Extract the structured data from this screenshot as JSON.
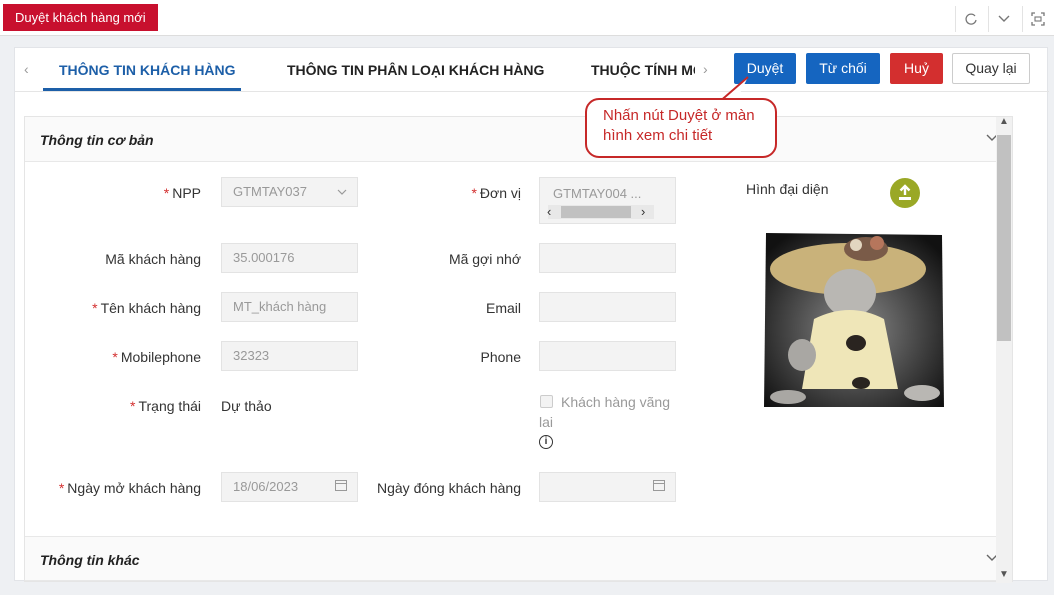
{
  "window": {
    "title": "Duyệt khách hàng mới",
    "controls": [
      "refresh-icon",
      "chevron-down-icon",
      "fullscreen-icon"
    ]
  },
  "tabs": {
    "items": [
      "THÔNG TIN KHÁCH HÀNG",
      "THÔNG TIN PHÂN LOẠI KHÁCH HÀNG",
      "THUỘC TÍNH MC"
    ],
    "prev_arrow": "‹",
    "next_arrow": "›"
  },
  "actions": {
    "approve": "Duyệt",
    "reject": "Từ chối",
    "cancel": "Huỷ",
    "back": "Quay lại"
  },
  "callout": {
    "text": "Nhấn nút Duyệt ở màn hình xem chi tiết"
  },
  "sections": {
    "basic": "Thông tin cơ bản",
    "other": "Thông tin khác"
  },
  "form": {
    "npp_label": "NPP",
    "npp_value": "GTMTAY037",
    "donvi_label": "Đơn vị",
    "donvi_value": "GTMTAY004 ...",
    "ma_kh_label": "Mã khách hàng",
    "ma_kh_value": "35.000176",
    "ma_goi_nho_label": "Mã gợi nhớ",
    "ma_goi_nho_value": "",
    "ten_kh_label": "Tên khách hàng",
    "ten_kh_value": "MT_khách hàng",
    "email_label": "Email",
    "email_value": "",
    "mobile_label": "Mobilephone",
    "mobile_value": "32323",
    "phone_label": "Phone",
    "phone_value": "",
    "trang_thai_label": "Trạng thái",
    "trang_thai_value": "Dự thảo",
    "vang_lai_label_1": "Khách hàng vãng",
    "vang_lai_label_2": "lai",
    "ngay_mo_label": "Ngày mở khách hàng",
    "ngay_mo_value": "18/06/2023",
    "ngay_dong_label": "Ngày đóng khách hàng",
    "ngay_dong_value": "",
    "avatar_label": "Hình đại diện",
    "required_mark": "*"
  },
  "colors": {
    "brand_red": "#c8102e",
    "primary_blue": "#1565c0",
    "active_tab": "#1d5fa8",
    "danger": "#d32f2f",
    "upload_green": "#9aa826"
  }
}
